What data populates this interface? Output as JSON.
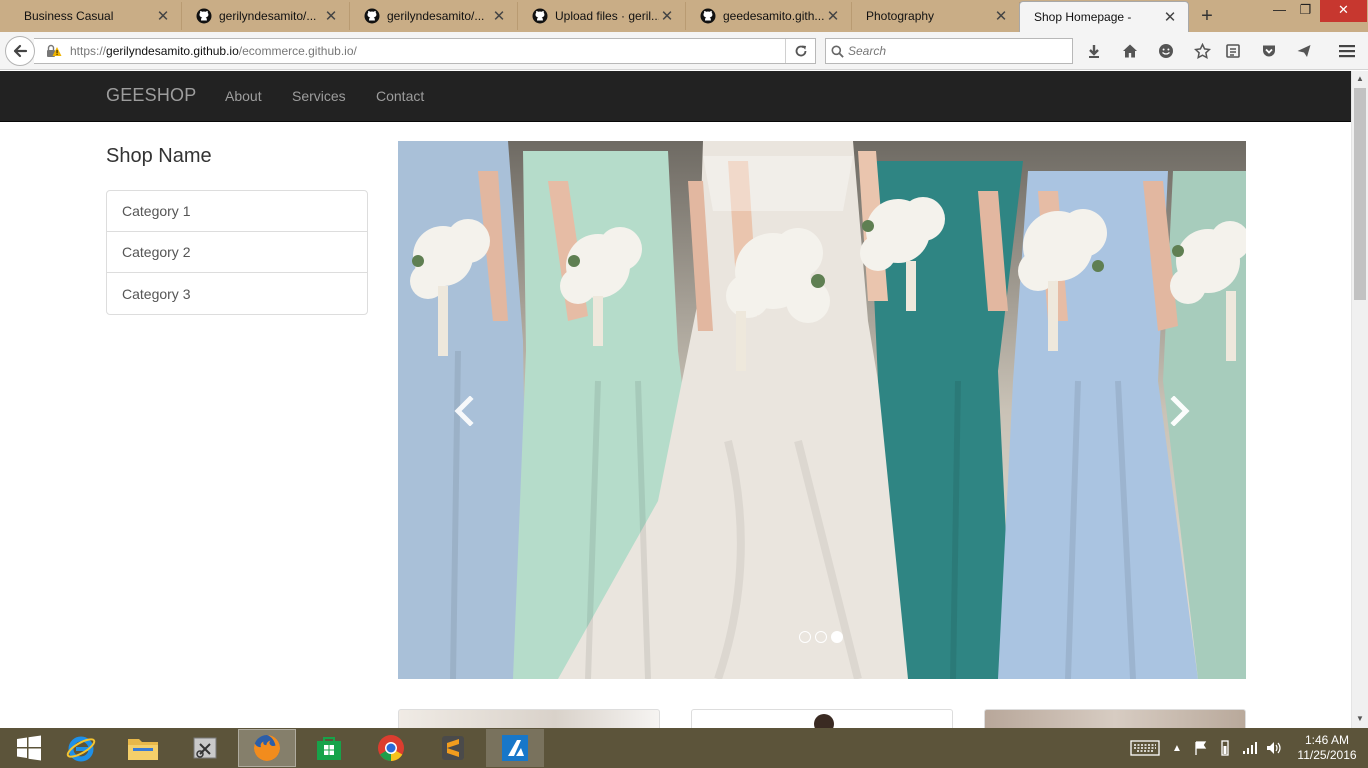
{
  "browser": {
    "tabs": [
      {
        "title": "Business Casual",
        "icon": "page-icon",
        "active": false
      },
      {
        "title": "gerilyndesamito/...",
        "icon": "github-icon",
        "active": false
      },
      {
        "title": "gerilyndesamito/...",
        "icon": "github-icon",
        "active": false
      },
      {
        "title": "Upload files · geril...",
        "icon": "github-icon",
        "active": false
      },
      {
        "title": "geedesamito.gith...",
        "icon": "github-icon",
        "active": false
      },
      {
        "title": "Photography",
        "icon": "page-icon",
        "active": false
      },
      {
        "title": "Shop Homepage -",
        "icon": "page-icon",
        "active": true
      }
    ],
    "new_tab": "+",
    "url_scheme": "https://",
    "url_host": "gerilyndesamito.github.io",
    "url_path": "/ecommerce.github.io/",
    "search_placeholder": "Search",
    "colors": {
      "tabbar": "#c9ad86",
      "close": "#c7372f"
    }
  },
  "site": {
    "brand": "GEESHOP",
    "nav_links": [
      "About",
      "Services",
      "Contact"
    ],
    "shop_name": "Shop Name",
    "categories": [
      "Category 1",
      "Category 2",
      "Category 3"
    ],
    "carousel": {
      "slide_count": 3,
      "active_slide": 3,
      "prev_icon": "chevron-left-icon",
      "next_icon": "chevron-right-icon"
    },
    "colors": {
      "navbar": "#222222",
      "navtext": "#9d9d9d"
    }
  },
  "taskbar": {
    "apps": [
      "windows-start-icon",
      "internet-explorer-icon",
      "file-explorer-icon",
      "snipping-tool-icon",
      "firefox-icon",
      "windows-store-icon",
      "chrome-icon",
      "sublime-text-icon",
      "azure-icon"
    ],
    "active_app": "firefox-icon",
    "time": "1:46 AM",
    "date": "11/25/2016"
  }
}
